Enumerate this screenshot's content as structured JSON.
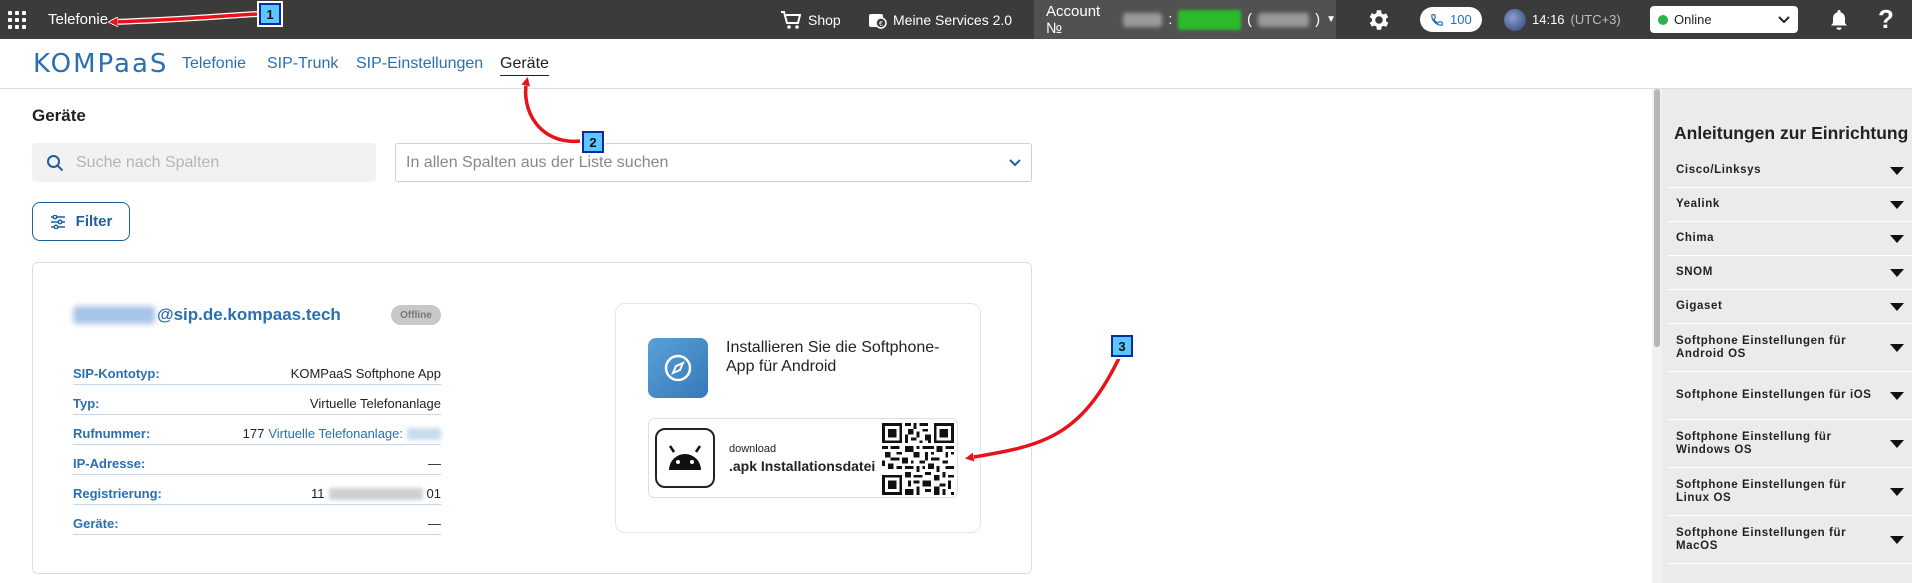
{
  "topbar": {
    "app_title": "Telefonie",
    "shop_label": "Shop",
    "services_label": "Meine Services 2.0",
    "account_label": "Account №",
    "account_sep": ":",
    "account_paren_open": "(",
    "account_paren_close": ")",
    "calls_count": "100",
    "time": "14:16",
    "timezone": "(UTC+3)",
    "status_value": "Online"
  },
  "subnav": {
    "logo": "KOMPaaS",
    "links": [
      {
        "label": "Telefonie"
      },
      {
        "label": "SIP-Trunk"
      },
      {
        "label": "SIP-Einstellungen"
      },
      {
        "label": "Geräte"
      }
    ],
    "active": "Geräte"
  },
  "main": {
    "title": "Geräte",
    "search_placeholder": "Suche nach Spalten",
    "column_select_placeholder": "In allen Spalten aus der Liste suchen",
    "filter_label": "Filter"
  },
  "device": {
    "sip_suffix": "@sip.de.kompaas.tech",
    "status": "Offline",
    "rows": [
      {
        "label": "SIP-Kontotyp:",
        "value": "KOMPaaS Softphone App"
      },
      {
        "label": "Typ:",
        "value": "Virtuelle Telefonanlage"
      },
      {
        "label": "Rufnummer:",
        "value": "177",
        "link": "Virtuelle Telefonanlage:"
      },
      {
        "label": "IP-Adresse:",
        "value": "—"
      },
      {
        "label": "Registrierung:",
        "value_start": "11",
        "value_end": "01"
      },
      {
        "label": "Geräte:",
        "value": "—"
      }
    ],
    "install": {
      "text": "Installieren Sie die Softphone-App für Android",
      "download_small": "download",
      "download_big": ".apk Installationsdatei"
    }
  },
  "sidebar": {
    "title": "Anleitungen zur Einrichtung",
    "items": [
      {
        "label": "Cisco/Linksys"
      },
      {
        "label": "Yealink"
      },
      {
        "label": "Chima"
      },
      {
        "label": "SNOM"
      },
      {
        "label": "Gigaset"
      },
      {
        "label": "Softphone Einstellungen für Android OS"
      },
      {
        "label": "Softphone Einstellungen für iOS"
      },
      {
        "label": "Softphone Einstellung für Windows OS"
      },
      {
        "label": "Softphone Einstellungen für Linux OS"
      },
      {
        "label": "Softphone Einstellungen für MacOS"
      }
    ]
  },
  "annotations": [
    {
      "number": "1"
    },
    {
      "number": "2"
    },
    {
      "number": "3"
    }
  ],
  "colors": {
    "topbar_bg": "#3b3b3b",
    "accent_blue": "#2c6fb0",
    "online_green": "#2ab34a",
    "annotation_arrow": "#e8121b",
    "badge_fill": "#5cc6ff"
  }
}
